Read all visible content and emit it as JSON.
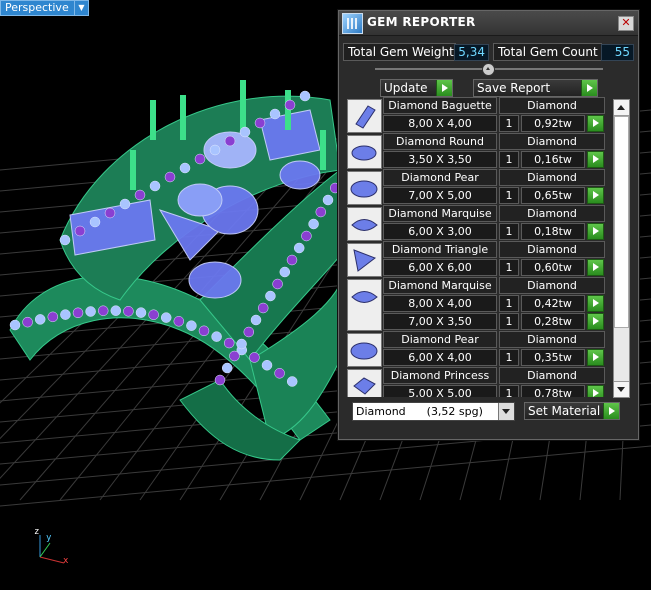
{
  "viewport": {
    "label": "Perspective",
    "axes": {
      "z": "z",
      "y": "y",
      "x": "x"
    }
  },
  "reporter": {
    "title": "GEM REPORTER",
    "total_weight_label": "Total Gem Weight",
    "total_weight_value": "5,34",
    "total_count_label": "Total Gem Count",
    "total_count_value": "55",
    "update_label": "Update",
    "save_label": "Save Report",
    "gems": [
      {
        "name": "Diamond Baguette",
        "material": "Diamond",
        "shape": "baguette",
        "lines": [
          {
            "size": "8,00 X 4,00",
            "count": "1",
            "weight": "0,92tw"
          }
        ]
      },
      {
        "name": "Diamond Round",
        "material": "Diamond",
        "shape": "round",
        "lines": [
          {
            "size": "3,50 X 3,50",
            "count": "1",
            "weight": "0,16tw"
          }
        ]
      },
      {
        "name": "Diamond Pear",
        "material": "Diamond",
        "shape": "pear",
        "lines": [
          {
            "size": "7,00 X 5,00",
            "count": "1",
            "weight": "0,65tw"
          }
        ]
      },
      {
        "name": "Diamond Marquise",
        "material": "Diamond",
        "shape": "marquise",
        "lines": [
          {
            "size": "6,00 X 3,00",
            "count": "1",
            "weight": "0,18tw"
          }
        ]
      },
      {
        "name": "Diamond Triangle",
        "material": "Diamond",
        "shape": "triangle",
        "lines": [
          {
            "size": "6,00 X 6,00",
            "count": "1",
            "weight": "0,60tw"
          }
        ]
      },
      {
        "name": "Diamond Marquise",
        "material": "Diamond",
        "shape": "marquise",
        "lines": [
          {
            "size": "8,00 X 4,00",
            "count": "1",
            "weight": "0,42tw"
          },
          {
            "size": "7,00 X 3,50",
            "count": "1",
            "weight": "0,28tw"
          }
        ]
      },
      {
        "name": "Diamond Pear",
        "material": "Diamond",
        "shape": "pear",
        "lines": [
          {
            "size": "6,00 X 4,00",
            "count": "1",
            "weight": "0,35tw"
          }
        ]
      },
      {
        "name": "Diamond Princess",
        "material": "Diamond",
        "shape": "princess",
        "lines": [
          {
            "size": "5,00 X 5,00",
            "count": "1",
            "weight": "0,78tw"
          }
        ]
      }
    ],
    "material_select": "Diamond      (3,52 spg)",
    "set_material_label": "Set Material"
  },
  "colors": {
    "panel_bg": "#2b2b2b",
    "value_text": "#6fd8ff",
    "go_green": "#3da82d",
    "ring_green": "#1f8a5a",
    "gem_blue": "#5a6fe0"
  }
}
